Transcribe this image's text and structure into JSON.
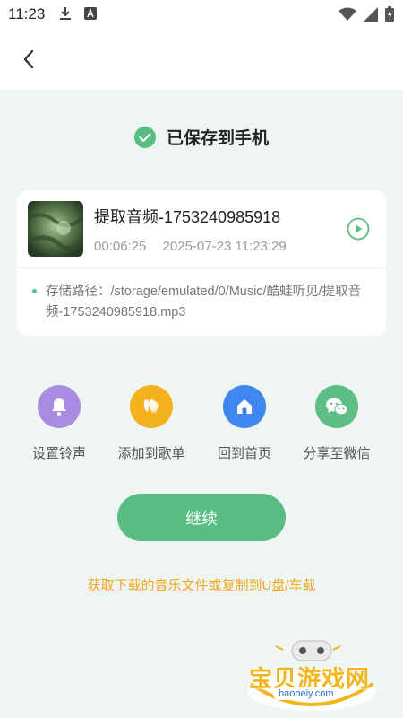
{
  "status_bar": {
    "time": "11:23"
  },
  "header": {
    "back_label": ""
  },
  "saved": {
    "title": "已保存到手机"
  },
  "file": {
    "name": "提取音频-1753240985918",
    "duration": "00:06:25",
    "datetime": "2025-07-23 11:23:29",
    "path": "存储路径：/storage/emulated/0/Music/酷蛙听见/提取音频-1753240985918.mp3"
  },
  "actions": [
    {
      "label": "设置铃声",
      "icon": "bell-icon",
      "color": "#a98be0"
    },
    {
      "label": "添加到歌单",
      "icon": "playlist-add-icon",
      "color": "#f5b21e"
    },
    {
      "label": "回到首页",
      "icon": "home-icon",
      "color": "#3f86ee"
    },
    {
      "label": "分享至微信",
      "icon": "wechat-icon",
      "color": "#5dbf85"
    }
  ],
  "continue_button": {
    "label": "继续"
  },
  "help_link": {
    "label": "获取下载的音乐文件或复制到U盘/车载"
  },
  "watermark": {
    "title": "宝贝游戏网",
    "url": "baobeiy.com"
  },
  "colors": {
    "accent": "#58bd80",
    "link": "#f0a81c",
    "background": "#eef5f3"
  }
}
